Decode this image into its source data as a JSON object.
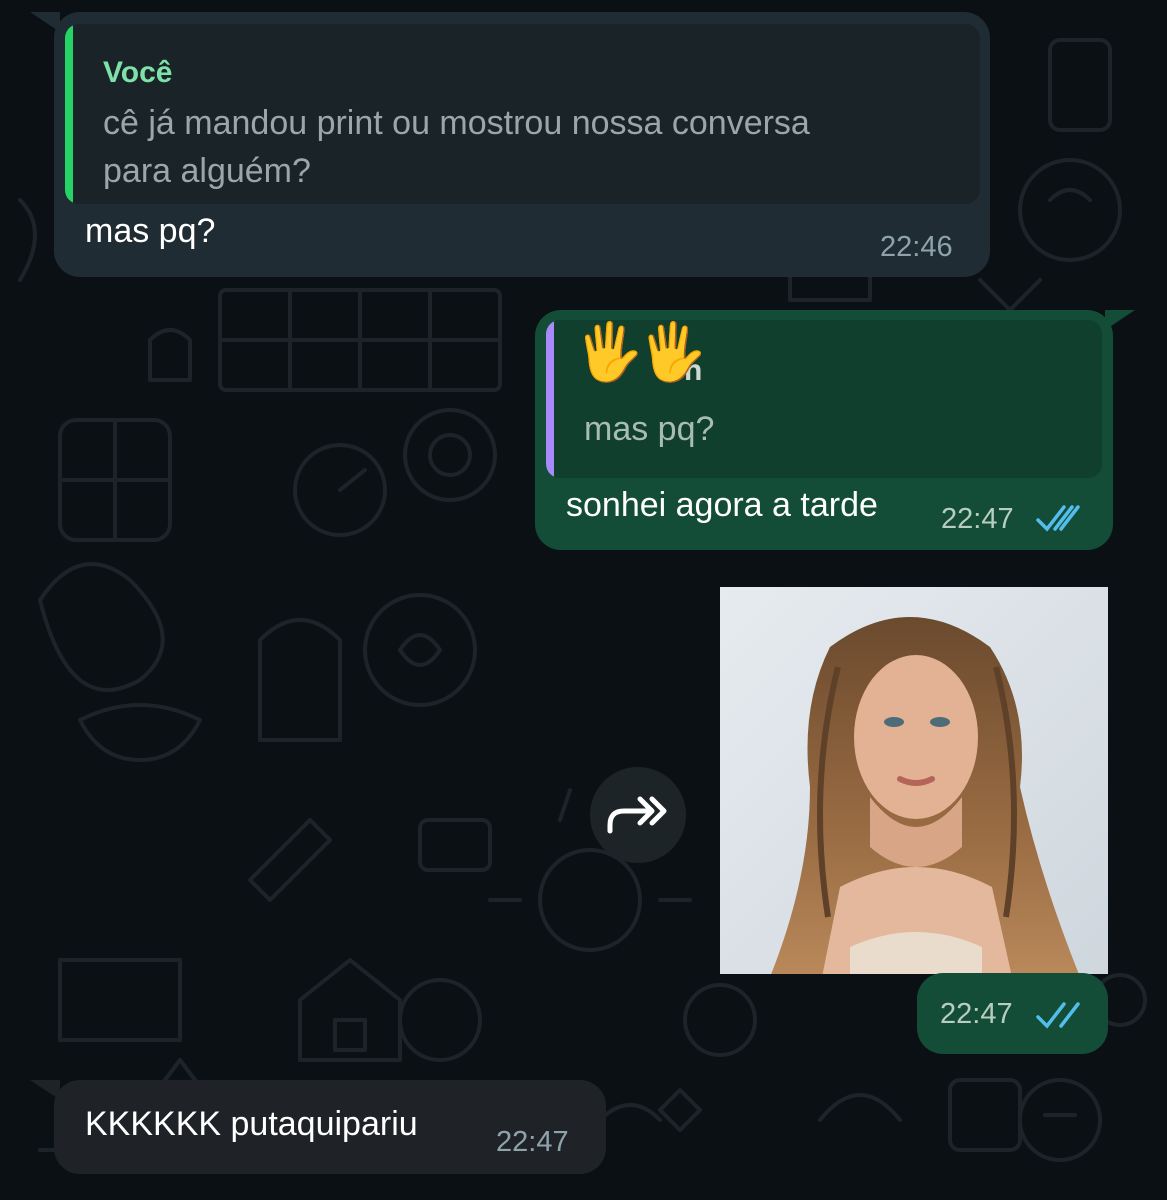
{
  "messages": [
    {
      "direction": "incoming",
      "quote": {
        "author": "Você",
        "text_line1": "cê já mandou print ou mostrou nossa conversa",
        "text_line2": "para alguém?"
      },
      "text": "mas pq?",
      "time": "22:46"
    },
    {
      "direction": "outgoing",
      "quote": {
        "author_emoji": "🖐🖐",
        "author_hidden_fragment": "n",
        "text": "mas pq?"
      },
      "text": "sonhei agora a tarde",
      "time": "22:47",
      "status": "read"
    },
    {
      "direction": "outgoing",
      "type": "image",
      "image_subject": "photo of a woman with long wavy hair",
      "time": "22:47",
      "status": "read"
    },
    {
      "direction": "incoming",
      "text": "KKKKKK putaquipariu",
      "time": "22:47"
    }
  ],
  "colors": {
    "background": "#0b1014",
    "incoming_bubble": "#202c33",
    "outgoing_bubble": "#144d37",
    "quote_bar_you": "#25d366",
    "quote_bar_other": "#a78bfa",
    "read_ticks": "#53bdeb"
  },
  "icons": {
    "forward": "forward-icon",
    "read_receipt": "double-check-icon"
  }
}
